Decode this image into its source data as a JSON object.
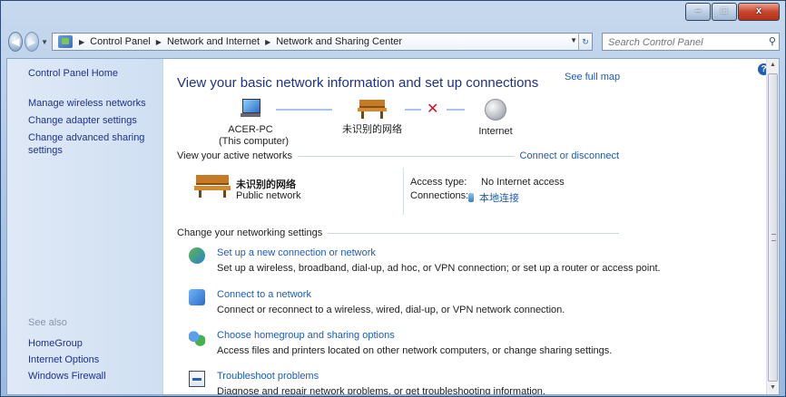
{
  "window": {
    "controls": {
      "minimize": "–",
      "maximize": "□",
      "close": "x"
    }
  },
  "nav": {
    "back_icon": "back-arrow-icon",
    "forward_icon": "forward-arrow-icon",
    "breadcrumbs": [
      "Control Panel",
      "Network and Internet",
      "Network and Sharing Center"
    ],
    "search_placeholder": "Search Control Panel"
  },
  "sidebar": {
    "home": "Control Panel Home",
    "tasks": [
      "Manage wireless networks",
      "Change adapter settings",
      "Change advanced sharing settings"
    ],
    "see_also_label": "See also",
    "see_also": [
      "HomeGroup",
      "Internet Options",
      "Windows Firewall"
    ]
  },
  "main": {
    "heading": "View your basic network information and set up connections",
    "see_full_map": "See full map",
    "map": {
      "computer_name": "ACER-PC",
      "computer_sub": "(This computer)",
      "network_name": "未识别的网络",
      "internet": "Internet",
      "status": "disconnected"
    },
    "active_section": {
      "title": "View your active networks",
      "connect_link": "Connect or disconnect",
      "network_name": "未识别的网络",
      "network_type": "Public network",
      "access_type_label": "Access type:",
      "access_type_value": "No Internet access",
      "connections_label": "Connections:",
      "connections_value": "本地连接"
    },
    "settings_section": {
      "title": "Change your networking settings",
      "items": [
        {
          "title": "Set up a new connection or network",
          "desc": "Set up a wireless, broadband, dial-up, ad hoc, or VPN connection; or set up a router or access point."
        },
        {
          "title": "Connect to a network",
          "desc": "Connect or reconnect to a wireless, wired, dial-up, or VPN network connection."
        },
        {
          "title": "Choose homegroup and sharing options",
          "desc": "Access files and printers located on other network computers, or change sharing settings."
        },
        {
          "title": "Troubleshoot problems",
          "desc": "Diagnose and repair network problems, or get troubleshooting information."
        }
      ]
    },
    "help_glyph": "?"
  },
  "colors": {
    "link": "#1e5bb5",
    "heading": "#1e3287",
    "sidebar_bg": "#dfe9f7",
    "error_x": "#d4121c"
  }
}
